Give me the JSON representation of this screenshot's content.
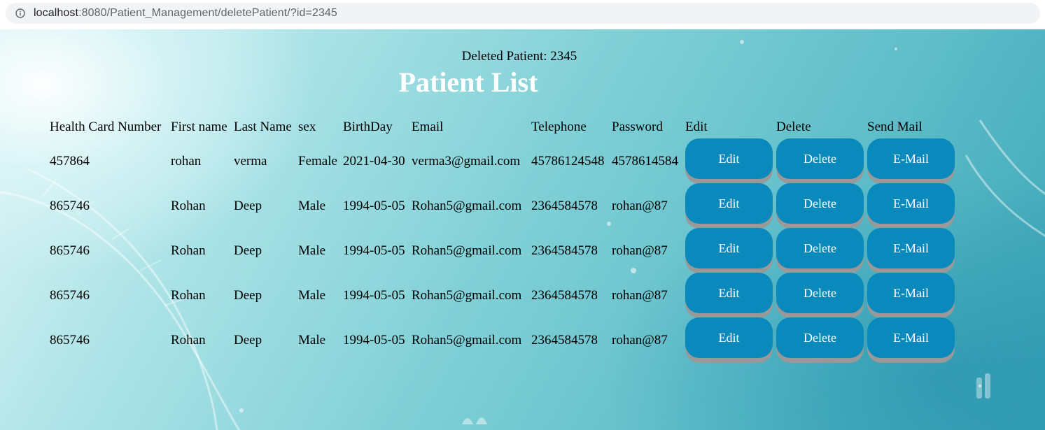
{
  "browser": {
    "url_host": "localhost",
    "url_rest": ":8080/Patient_Management/deletePatient/?id=2345"
  },
  "page": {
    "deleted_message": "Deleted Patient: 2345",
    "title": "Patient List"
  },
  "table": {
    "headers": [
      "Health Card Number",
      "First name",
      "Last Name",
      "sex",
      "BirthDay",
      "Email",
      "Telephone",
      "Password",
      "Edit",
      "Delete",
      "Send Mail"
    ],
    "rows": [
      {
        "card": "457864",
        "first": "rohan",
        "last": "verma",
        "sex": "Female",
        "birthday": "2021-04-30",
        "email": "verma3@gmail.com",
        "phone": "45786124548",
        "password": "4578614584"
      },
      {
        "card": "865746",
        "first": "Rohan",
        "last": "Deep",
        "sex": "Male",
        "birthday": "1994-05-05",
        "email": "Rohan5@gmail.com",
        "phone": "2364584578",
        "password": "rohan@87"
      },
      {
        "card": "865746",
        "first": "Rohan",
        "last": "Deep",
        "sex": "Male",
        "birthday": "1994-05-05",
        "email": "Rohan5@gmail.com",
        "phone": "2364584578",
        "password": "rohan@87"
      },
      {
        "card": "865746",
        "first": "Rohan",
        "last": "Deep",
        "sex": "Male",
        "birthday": "1994-05-05",
        "email": "Rohan5@gmail.com",
        "phone": "2364584578",
        "password": "rohan@87"
      },
      {
        "card": "865746",
        "first": "Rohan",
        "last": "Deep",
        "sex": "Male",
        "birthday": "1994-05-05",
        "email": "Rohan5@gmail.com",
        "phone": "2364584578",
        "password": "rohan@87"
      }
    ],
    "buttons": {
      "edit": "Edit",
      "delete": "Delete",
      "mail": "E-Mail"
    }
  },
  "colors": {
    "button": "#0a89bd",
    "button_shadow": "#999999",
    "title": "#ffffff"
  }
}
